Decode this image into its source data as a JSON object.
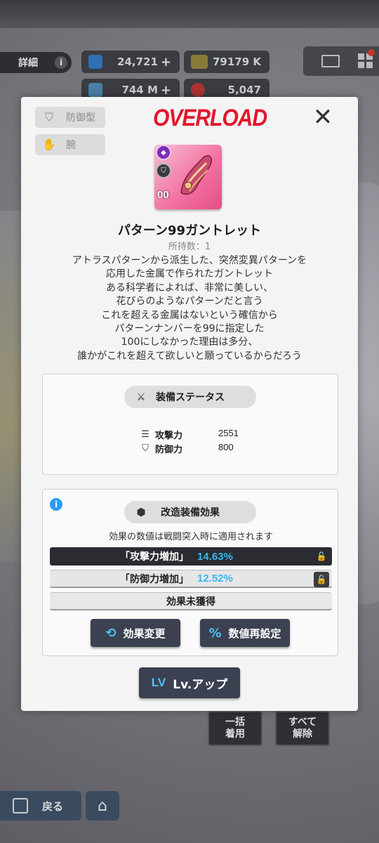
{
  "background": {
    "detail_label": "詳細",
    "info_glyph": "i",
    "resources": [
      {
        "value": "24,721",
        "plus": "+"
      },
      {
        "value": "79179 K"
      },
      {
        "value": "744 M",
        "plus": "+"
      },
      {
        "value": "5,047"
      }
    ],
    "bottom_buttons": {
      "equip_all": "一括\n着用",
      "unequip_all": "すべて\n解除"
    },
    "back_label": "戻る"
  },
  "modal": {
    "tags": {
      "type": "防御型",
      "slot": "腕"
    },
    "brand": "OVERLOAD",
    "close_glyph": "✕",
    "item": {
      "level": "00",
      "name": "パターン99ガントレット",
      "owned": "所持数：1",
      "description": [
        "アトラスパターンから派生した、突然変異パターンを",
        "応用した金属で作られたガントレット",
        "ある科学者によれば、非常に美しい、",
        "花びらのようなパターンだと言う",
        "これを超える金属はないという確信から",
        "パターンナンバーを99に指定した",
        "100にしなかった理由は多分、",
        "誰かがこれを超えて欲しいと願っているからだろう"
      ]
    },
    "equip_status": {
      "title": "装備ステータス",
      "stats": [
        {
          "label": "攻撃力",
          "value": "2551",
          "icon": "attack-icon"
        },
        {
          "label": "防御力",
          "value": "800",
          "icon": "defense-icon"
        }
      ]
    },
    "mod_effect": {
      "title": "改造装備効果",
      "note": "効果の数値は戦闘突入時に適用されます",
      "effects": [
        {
          "name": "「攻撃力増加」",
          "value": "14.63%"
        },
        {
          "name": "「防御力増加」",
          "value": "12.52%"
        }
      ],
      "empty_label": "効果未獲得",
      "change_button": "効果変更",
      "reset_button": "数値再設定"
    },
    "lvup": {
      "prefix": "LV",
      "label": "Lv.アップ"
    }
  },
  "colors": {
    "brand_red": "#e3172c",
    "accent_blue": "#3ab6ef",
    "button_dark": "#3b4150",
    "item_pink": "#f26fa0"
  }
}
